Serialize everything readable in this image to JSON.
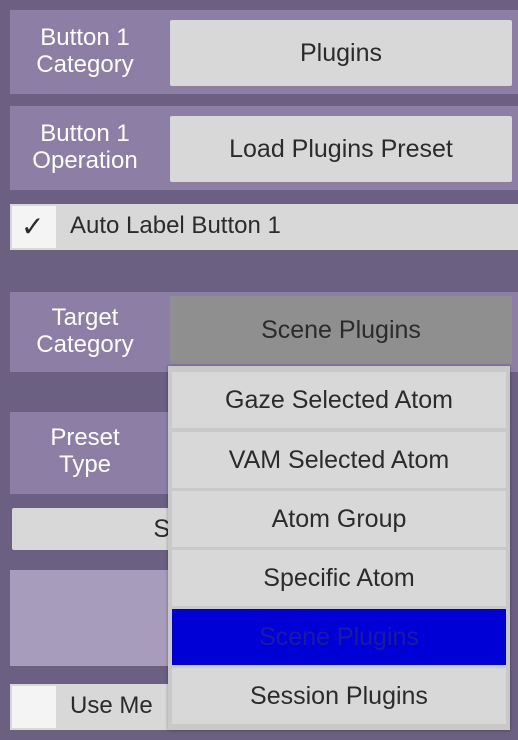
{
  "rows": {
    "button_category": {
      "label": "Button 1\nCategory",
      "value": "Plugins"
    },
    "button_operation": {
      "label": "Button 1\nOperation",
      "value": "Load Plugins Preset"
    },
    "auto_label": {
      "label": "Auto Label Button 1",
      "checked": true,
      "check_glyph": "✓"
    },
    "target_category": {
      "label": "Target\nCategory",
      "value": "Scene Plugins"
    },
    "preset_type": {
      "label": "Preset\nType"
    },
    "partial_s": {
      "text": "S"
    },
    "use_me": {
      "text": "Use Me"
    }
  },
  "dropdown": {
    "options": [
      {
        "label": "Gaze Selected Atom"
      },
      {
        "label": "VAM Selected Atom"
      },
      {
        "label": "Atom Group"
      },
      {
        "label": "Specific Atom"
      },
      {
        "label": "Scene Plugins",
        "selected": true
      },
      {
        "label": "Session Plugins"
      }
    ]
  },
  "colors": {
    "panel_background": "#6b5f82",
    "row_background": "#8d7ea6",
    "button_background": "#d8d8d8",
    "dropdown_open_background": "#8f8f8f",
    "selected_option": "#0000d6"
  }
}
